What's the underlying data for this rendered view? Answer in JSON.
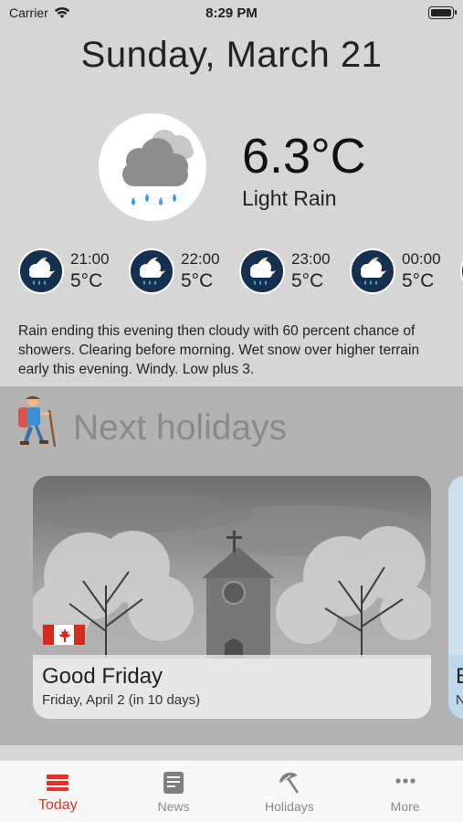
{
  "status_bar": {
    "carrier": "Carrier",
    "time": "8:29 PM"
  },
  "date_title": "Sunday, March 21",
  "current": {
    "temperature": "6.3°C",
    "condition": "Light Rain",
    "icon": "rain-cloud-icon"
  },
  "hourly": [
    {
      "time": "21:00",
      "temp": "5°C",
      "icon": "night-rain-icon"
    },
    {
      "time": "22:00",
      "temp": "5°C",
      "icon": "night-rain-icon"
    },
    {
      "time": "23:00",
      "temp": "5°C",
      "icon": "night-rain-icon"
    },
    {
      "time": "00:00",
      "temp": "5°C",
      "icon": "night-rain-icon"
    }
  ],
  "forecast_text": "Rain ending this evening then cloudy with 60 percent chance of showers. Clearing before morning. Wet snow over higher terrain early this evening. Windy. Low plus 3.",
  "holidays": {
    "title": "Next holidays",
    "cards": [
      {
        "name": "Good Friday",
        "date": "Friday, April 2 (in 10 days)",
        "flag": "canada-flag-icon"
      }
    ],
    "peek_card": {
      "name_initial": "E",
      "date_initial": "N"
    }
  },
  "tabs": [
    {
      "label": "Today",
      "icon": "calendar-icon",
      "active": true
    },
    {
      "label": "News",
      "icon": "news-icon",
      "active": false
    },
    {
      "label": "Holidays",
      "icon": "beach-umbrella-icon",
      "active": false
    },
    {
      "label": "More",
      "icon": "more-dots-icon",
      "active": false
    }
  ],
  "colors": {
    "accent": "#e2342a",
    "hour_icon_bg": "#15304f",
    "inactive_tab": "#8a8a8a"
  }
}
